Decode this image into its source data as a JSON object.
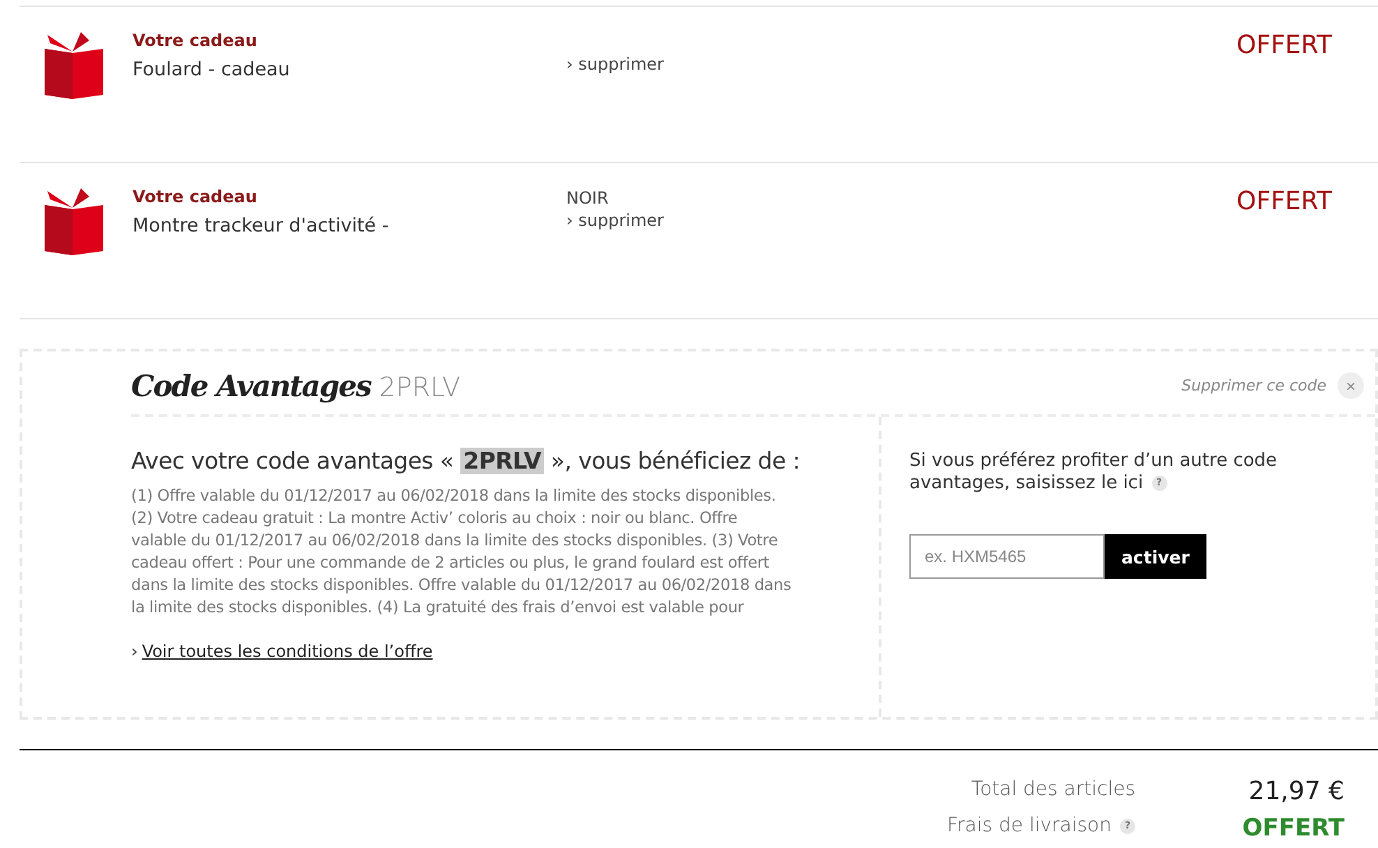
{
  "gifts": [
    {
      "label": "Votre cadeau",
      "name": "Foulard - cadeau",
      "remove": "› supprimer",
      "price": "OFFERT"
    },
    {
      "label": "Votre cadeau",
      "name": "Montre trackeur d'activité -",
      "option": "NOIR",
      "remove": "› supprimer",
      "price": "OFFERT"
    }
  ],
  "promo": {
    "title": "Code Avantages",
    "code": "2PRLV",
    "remove_label": "Supprimer ce code",
    "close": "×",
    "headline": "Avec votre code avantages « **2PRLV** », vous bénéficiez de :",
    "conditions": "(1) Offre valable du 01/12/2017 au 06/02/2018 dans la limite des stocks disponibles. (2) Votre cadeau gratuit : La montre Activ’ coloris au choix : noir ou blanc. Offre valable du 01/12/2017 au 06/02/2018 dans la limite des stocks disponibles. (3) Votre cadeau offert : Pour une commande de 2 articles ou plus, le grand foulard est offert dans la limite des stocks disponibles. Offre valable du 01/12/2017 au 06/02/2018 dans la limite des stocks disponibles. (4) La gratuité des frais d’envoi est valable pour",
    "link_prefix": "›",
    "link": "Voir toutes les conditions de l’offre",
    "other_prompt": "Si vous préférez profiter d’un autre code avantages, saisissez le ici",
    "help": "?",
    "placeholder": "ex. HXM5465",
    "button": "activer"
  },
  "totals": [
    {
      "label": "Total des articles",
      "value": "21,97 €",
      "kind": "amount"
    },
    {
      "label": "Frais de livraison",
      "help": "?",
      "value": "OFFERT",
      "kind": "free"
    }
  ]
}
